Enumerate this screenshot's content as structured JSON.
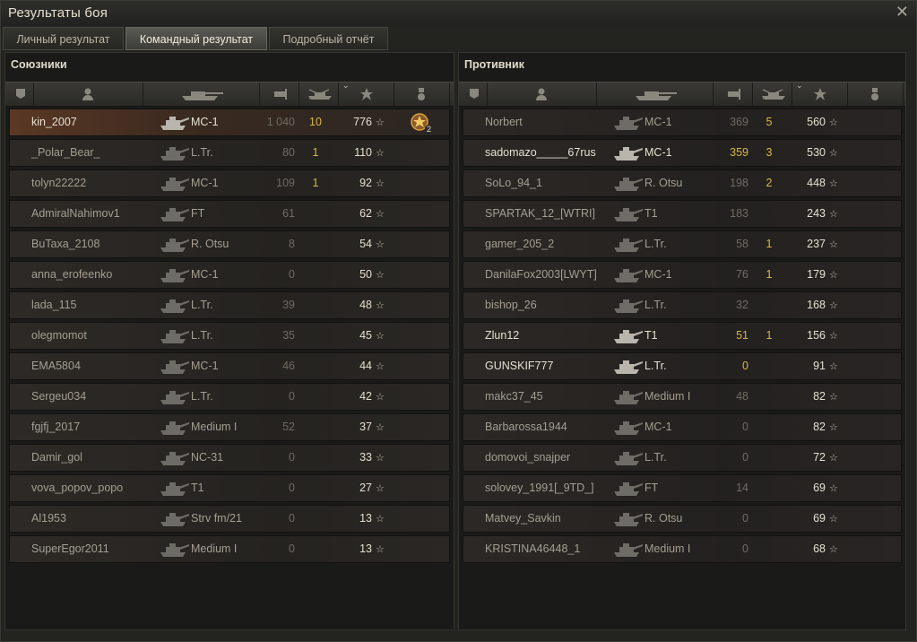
{
  "window": {
    "title": "Результаты боя",
    "close_icon": "close-icon"
  },
  "tabs": [
    {
      "label": "Личный результат",
      "active": false
    },
    {
      "label": "Командный результат",
      "active": true
    },
    {
      "label": "Подробный отчёт",
      "active": false
    }
  ],
  "allies": {
    "title": "Союзники",
    "rows": [
      {
        "player": "kin_2007",
        "tank": "MC-1",
        "damage": "1 040",
        "kills": "10",
        "xp": "776",
        "medal": "2",
        "self": true
      },
      {
        "player": "_Polar_Bear_",
        "tank": "L.Tr.",
        "damage": "80",
        "kills": "1",
        "xp": "110"
      },
      {
        "player": "tolyn22222",
        "tank": "MC-1",
        "damage": "109",
        "kills": "1",
        "xp": "92"
      },
      {
        "player": "AdmiralNahimov1",
        "tank": "FT",
        "damage": "61",
        "kills": "",
        "xp": "62"
      },
      {
        "player": "BuTaxa_2108",
        "tank": "R. Otsu",
        "damage": "8",
        "kills": "",
        "xp": "54"
      },
      {
        "player": "anna_erofeenko",
        "tank": "MC-1",
        "damage": "0",
        "kills": "",
        "xp": "50"
      },
      {
        "player": "lada_115",
        "tank": "L.Tr.",
        "damage": "39",
        "kills": "",
        "xp": "48"
      },
      {
        "player": "olegmomot",
        "tank": "L.Tr.",
        "damage": "35",
        "kills": "",
        "xp": "45"
      },
      {
        "player": "EMA5804",
        "tank": "MC-1",
        "damage": "46",
        "kills": "",
        "xp": "44"
      },
      {
        "player": "Sergeu034",
        "tank": "L.Tr.",
        "damage": "0",
        "kills": "",
        "xp": "42"
      },
      {
        "player": "fgjfj_2017",
        "tank": "Medium I",
        "damage": "52",
        "kills": "",
        "xp": "37"
      },
      {
        "player": "Damir_gol",
        "tank": "NC-31",
        "damage": "0",
        "kills": "",
        "xp": "33"
      },
      {
        "player": "vova_popov_popo",
        "tank": "T1",
        "damage": "0",
        "kills": "",
        "xp": "27"
      },
      {
        "player": "Al1953",
        "tank": "Strv fm/21",
        "damage": "0",
        "kills": "",
        "xp": "13"
      },
      {
        "player": "SuperEgor2011",
        "tank": "Medium I",
        "damage": "0",
        "kills": "",
        "xp": "13"
      }
    ]
  },
  "enemies": {
    "title": "Противник",
    "rows": [
      {
        "player": "Norbert",
        "tank": "MC-1",
        "damage": "369",
        "kills": "5",
        "xp": "560"
      },
      {
        "player": "sadomazo_____67rus",
        "tank": "MC-1",
        "damage": "359",
        "kills": "3",
        "xp": "530",
        "alive": true
      },
      {
        "player": "SoLo_94_1",
        "tank": "R. Otsu",
        "damage": "198",
        "kills": "2",
        "xp": "448"
      },
      {
        "player": "SPARTAK_12_[WTRI]",
        "tank": "T1",
        "damage": "183",
        "kills": "",
        "xp": "243"
      },
      {
        "player": "gamer_205_2",
        "tank": "L.Tr.",
        "damage": "58",
        "kills": "1",
        "xp": "237"
      },
      {
        "player": "DanilaFox2003[LWYT]",
        "tank": "MC-1",
        "damage": "76",
        "kills": "1",
        "xp": "179"
      },
      {
        "player": "bishop_26",
        "tank": "L.Tr.",
        "damage": "32",
        "kills": "",
        "xp": "168"
      },
      {
        "player": "Zlun12",
        "tank": "T1",
        "damage": "51",
        "kills": "1",
        "xp": "156",
        "alive": true
      },
      {
        "player": "GUNSKIF777",
        "tank": "L.Tr.",
        "damage": "0",
        "kills": "",
        "xp": "91",
        "alive": true
      },
      {
        "player": "makc37_45",
        "tank": "Medium I",
        "damage": "48",
        "kills": "",
        "xp": "82"
      },
      {
        "player": "Barbarossa1944",
        "tank": "MC-1",
        "damage": "0",
        "kills": "",
        "xp": "82"
      },
      {
        "player": "domovoi_snajper",
        "tank": "L.Tr.",
        "damage": "0",
        "kills": "",
        "xp": "72"
      },
      {
        "player": "solovey_1991[_9TD_]",
        "tank": "FT",
        "damage": "14",
        "kills": "",
        "xp": "69"
      },
      {
        "player": "Matvey_Savkin",
        "tank": "R. Otsu",
        "damage": "0",
        "kills": "",
        "xp": "69"
      },
      {
        "player": "KRISTINA46448_1",
        "tank": "Medium I",
        "damage": "0",
        "kills": "",
        "xp": "68"
      }
    ]
  },
  "icons": {
    "header": [
      "squad-icon",
      "player-icon",
      "tank-icon",
      "damage-icon",
      "kills-icon",
      "xp-star-icon",
      "medal-icon"
    ],
    "row": [
      "tank-silhouette-icon",
      "star-icon",
      "medal-badge-icon"
    ]
  },
  "colors": {
    "gold": "#d8b848",
    "text": "#c8c2b4",
    "dim": "#6f6b63",
    "self_row": "#5a3824"
  }
}
